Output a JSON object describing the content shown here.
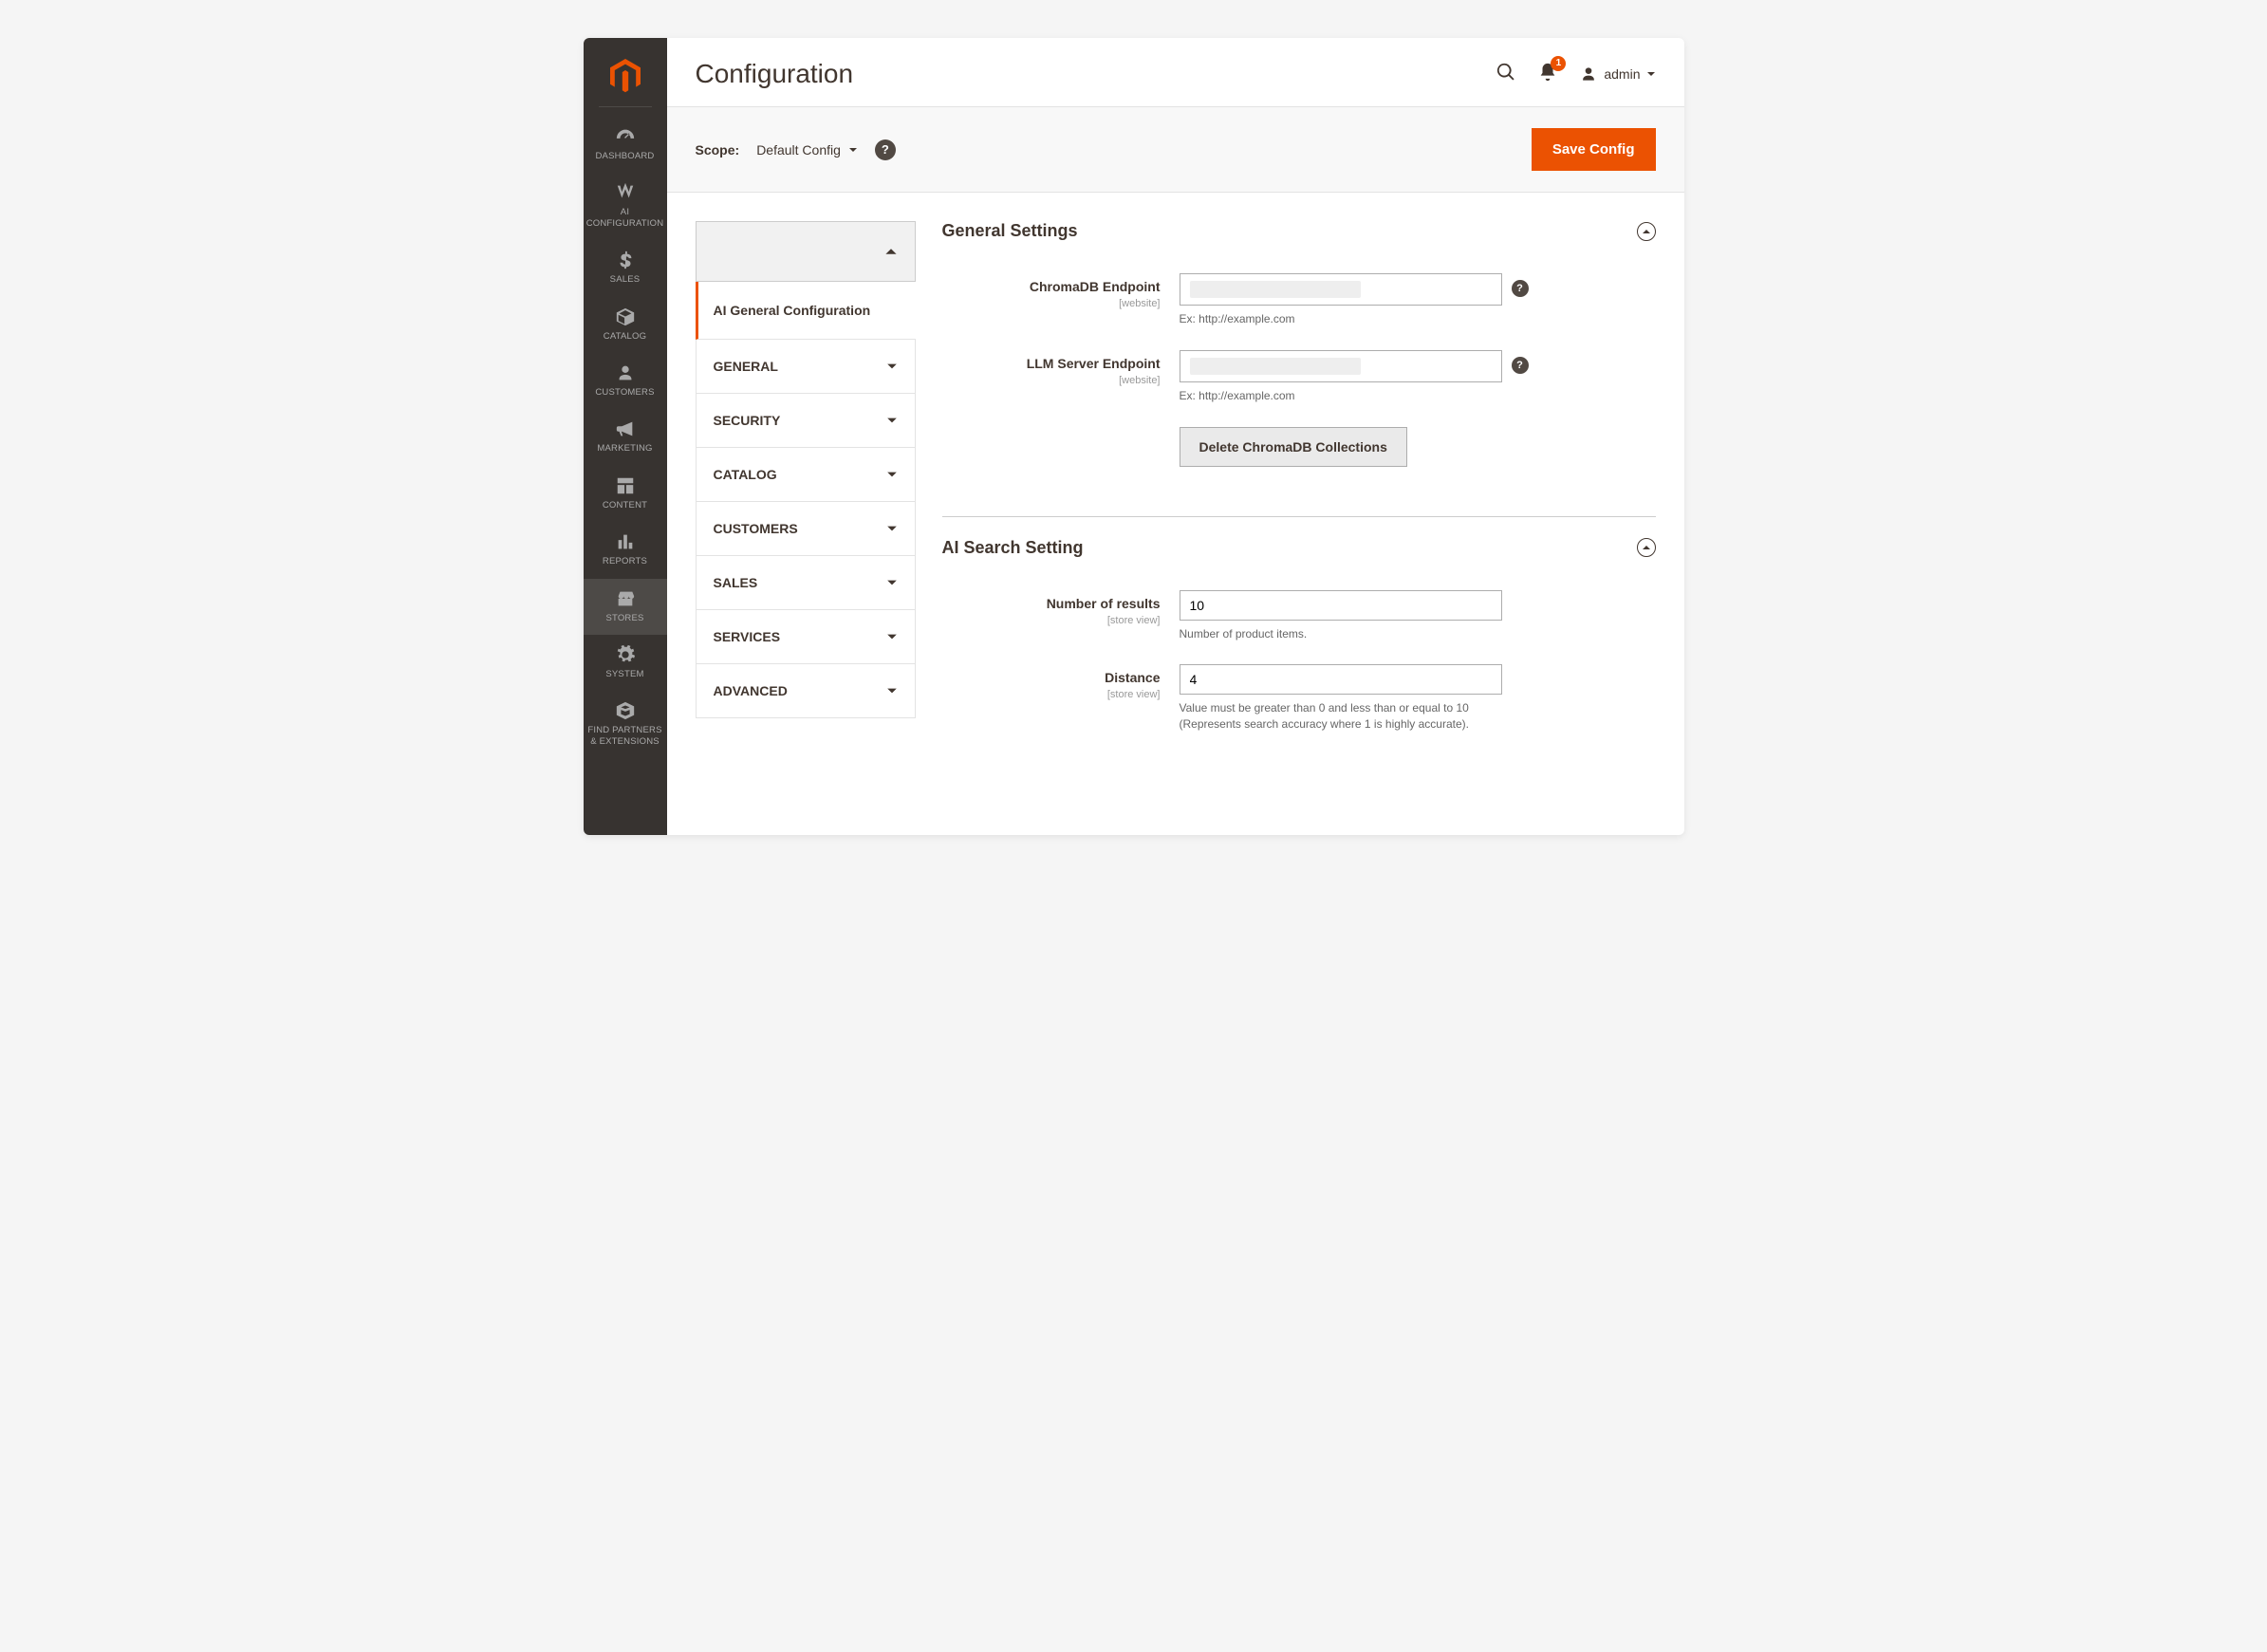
{
  "header": {
    "title": "Configuration",
    "notifications_count": "1",
    "user_label": "admin"
  },
  "scope": {
    "label": "Scope:",
    "value": "Default Config",
    "save_label": "Save Config"
  },
  "sidebar": {
    "items": [
      {
        "label": "DASHBOARD"
      },
      {
        "label": "AI CONFIGURATION"
      },
      {
        "label": "SALES"
      },
      {
        "label": "CATALOG"
      },
      {
        "label": "CUSTOMERS"
      },
      {
        "label": "MARKETING"
      },
      {
        "label": "CONTENT"
      },
      {
        "label": "REPORTS"
      },
      {
        "label": "STORES"
      },
      {
        "label": "SYSTEM"
      },
      {
        "label": "FIND PARTNERS & EXTENSIONS"
      }
    ]
  },
  "config_nav": {
    "active": "AI General Configuration",
    "items": [
      {
        "label": "GENERAL"
      },
      {
        "label": "SECURITY"
      },
      {
        "label": "CATALOG"
      },
      {
        "label": "CUSTOMERS"
      },
      {
        "label": "SALES"
      },
      {
        "label": "SERVICES"
      },
      {
        "label": "ADVANCED"
      }
    ]
  },
  "sections": {
    "general": {
      "title": "General Settings",
      "fields": {
        "chromadb": {
          "label": "ChromaDB Endpoint",
          "scope": "[website]",
          "value": "",
          "note": "Ex: http://example.com"
        },
        "llm": {
          "label": "LLM Server Endpoint",
          "scope": "[website]",
          "value": "",
          "note": "Ex: http://example.com"
        },
        "delete_btn": "Delete ChromaDB Collections"
      }
    },
    "search": {
      "title": "AI Search Setting",
      "fields": {
        "results": {
          "label": "Number of results",
          "scope": "[store view]",
          "value": "10",
          "note": "Number of product items."
        },
        "distance": {
          "label": "Distance",
          "scope": "[store view]",
          "value": "4",
          "note": "Value must be greater than 0 and less than or equal to 10 (Represents search accuracy where 1 is highly accurate)."
        }
      }
    }
  }
}
